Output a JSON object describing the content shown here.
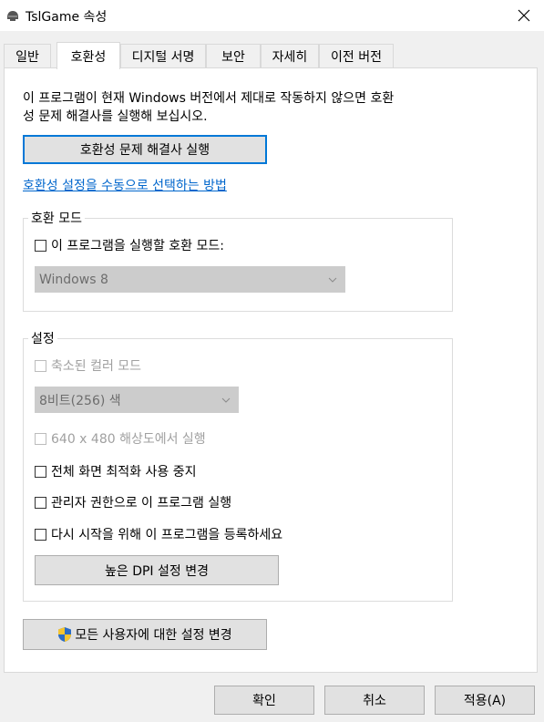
{
  "window": {
    "title": "TslGame 속성",
    "close_icon": "close-icon"
  },
  "tabs": [
    {
      "label": "일반",
      "active": false
    },
    {
      "label": "호환성",
      "active": true
    },
    {
      "label": "디지털 서명",
      "active": false
    },
    {
      "label": "보안",
      "active": false
    },
    {
      "label": "자세히",
      "active": false
    },
    {
      "label": "이전 버전",
      "active": false
    }
  ],
  "compat": {
    "description_line1": "이 프로그램이 현재 Windows 버전에서 제대로 작동하지 않으면 호환",
    "description_line2": "성 문제 해결사를 실행해 보십시오.",
    "troubleshooter_button": "호환성 문제 해결사 실행",
    "manual_link": "호환성 설정을 수동으로 선택하는 방법"
  },
  "compat_mode": {
    "group_label": "호환 모드",
    "checkbox_label": "이 프로그램을 실행할 호환 모드:",
    "checked": false,
    "select_value": "Windows 8",
    "select_enabled": false
  },
  "settings": {
    "group_label": "설정",
    "reduced_color": {
      "label": "축소된 컬러 모드",
      "enabled": false,
      "checked": false
    },
    "color_select_value": "8비트(256) 색",
    "res_640": {
      "label": "640 x 480 해상도에서 실행",
      "enabled": false,
      "checked": false
    },
    "disable_fullscreen_opt": {
      "label": "전체 화면 최적화 사용 중지",
      "enabled": true,
      "checked": false
    },
    "run_as_admin": {
      "label": "관리자 권한으로 이 프로그램 실행",
      "enabled": true,
      "checked": false
    },
    "register_restart": {
      "label": "다시 시작을 위해 이 프로그램을 등록하세요",
      "enabled": true,
      "checked": false
    },
    "high_dpi_button": "높은 DPI 설정 변경"
  },
  "all_users_button": {
    "label": "모든 사용자에 대한 설정 변경",
    "icon": "uac-shield-icon"
  },
  "footer": {
    "ok": "확인",
    "cancel": "취소",
    "apply": "적용(A)"
  },
  "colors": {
    "link": "#0066cc",
    "focus_border": "#0078d7",
    "disabled_text": "#a0a0a0"
  }
}
